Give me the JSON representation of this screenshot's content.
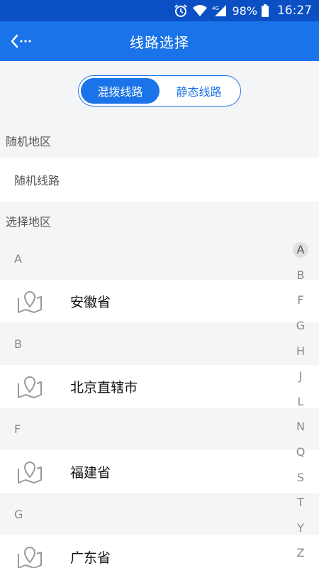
{
  "status_bar": {
    "battery": "98%",
    "time": "16:27",
    "network_tag": "4G"
  },
  "app_bar": {
    "title": "线路选择",
    "back_icon": "back-arrow-icon"
  },
  "segment": {
    "options": [
      "混拨线路",
      "静态线路"
    ],
    "selected_index": 0
  },
  "random_section": {
    "header": "随机地区",
    "item": "随机线路"
  },
  "select_section": {
    "header": "选择地区"
  },
  "groups": [
    {
      "letter": "A",
      "province": "安徽省"
    },
    {
      "letter": "B",
      "province": "北京直辖市"
    },
    {
      "letter": "F",
      "province": "福建省"
    },
    {
      "letter": "G",
      "province": "广东省"
    }
  ],
  "index_letters": [
    "A",
    "B",
    "F",
    "G",
    "H",
    "J",
    "L",
    "N",
    "Q",
    "S",
    "T",
    "Y",
    "Z"
  ],
  "colors": {
    "primary": "#1a73e8",
    "status_bar": "#0a4fc4",
    "background": "#f4f5f7"
  }
}
